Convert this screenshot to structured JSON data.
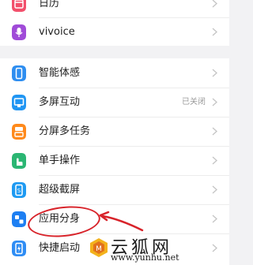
{
  "top_group": {
    "items": [
      {
        "label": "日历",
        "icon": "calendar-icon",
        "color": "#f24f6b"
      },
      {
        "label": "vivoice",
        "icon": "microphone-icon",
        "color": "#a04bd8"
      }
    ]
  },
  "main_group": {
    "items": [
      {
        "label": "智能体感",
        "icon": "phone-motion-icon",
        "color": "#2e8ef0",
        "value": ""
      },
      {
        "label": "多屏互动",
        "icon": "cast-icon",
        "color": "#2196f3",
        "value": "已关闭"
      },
      {
        "label": "分屏多任务",
        "icon": "split-screen-icon",
        "color": "#ff8a1c",
        "value": ""
      },
      {
        "label": "单手操作",
        "icon": "hand-icon",
        "color": "#2bb673",
        "value": ""
      },
      {
        "label": "超级截屏",
        "icon": "screenshot-icon",
        "color": "#1e9af2",
        "value": ""
      },
      {
        "label": "应用分身",
        "icon": "app-clone-icon",
        "color": "#1e7ff2",
        "value": ""
      },
      {
        "label": "快捷启动",
        "icon": "quick-launch-icon",
        "color": "#2f8df4",
        "value": ""
      }
    ]
  },
  "watermark": {
    "text": "云狐网",
    "url": "www.yunhu.net"
  },
  "annotation_color": "#d8232a"
}
